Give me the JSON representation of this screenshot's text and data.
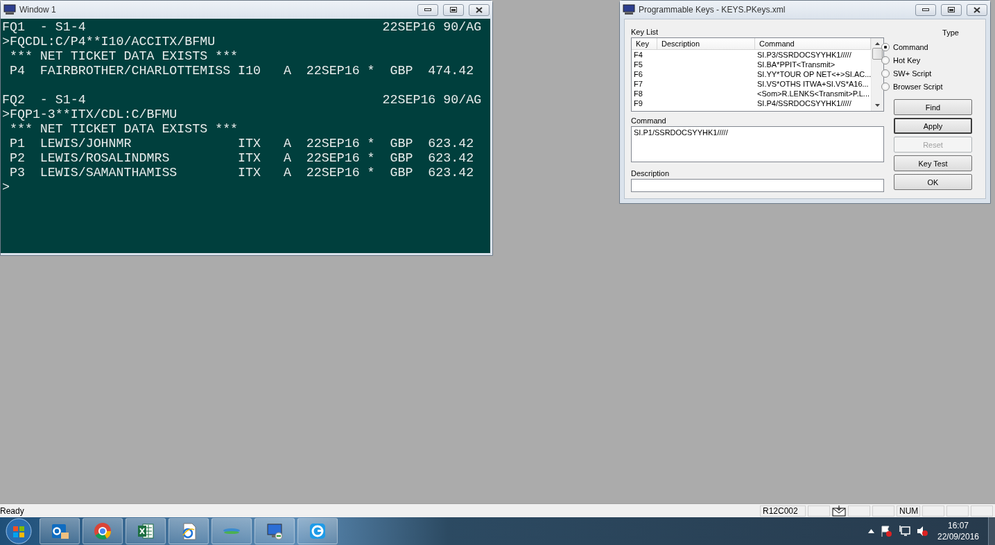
{
  "terminal_window": {
    "title": "Window 1",
    "blocks": [
      {
        "lines": [
          "FQ1  - S1-4                                       22SEP16 90/AG",
          ">FQCDL:C/P4**I10/ACCITX/BFMU",
          " *** NET TICKET DATA EXISTS ***",
          " P4  FAIRBROTHER/CHARLOTTEMISS I10   A  22SEP16 *  GBP  474.42"
        ]
      },
      {
        "lines": [
          "FQ2  - S1-4                                       22SEP16 90/AG",
          ">FQP1-3**ITX/CDL:C/BFMU",
          " *** NET TICKET DATA EXISTS ***",
          " P1  LEWIS/JOHNMR              ITX   A  22SEP16 *  GBP  623.42",
          " P2  LEWIS/ROSALINDMRS         ITX   A  22SEP16 *  GBP  623.42",
          " P3  LEWIS/SAMANTHAMISS        ITX   A  22SEP16 *  GBP  623.42",
          ">"
        ]
      }
    ]
  },
  "keys_window": {
    "title": "Programmable Keys - KEYS.PKeys.xml",
    "key_list": {
      "label": "Key List",
      "columns": [
        "Key",
        "Description",
        "Command"
      ],
      "rows": [
        {
          "key": "F4",
          "command": "SI.P3/SSRDOCSYYHK1/////"
        },
        {
          "key": "F5",
          "command": "SI.BA*PPIT<Transmit>"
        },
        {
          "key": "F6",
          "command": "SI.YY*TOUR OP NET<+>SI.AC..."
        },
        {
          "key": "F7",
          "command": "SI.VS*OTHS ITWA+SI.VS*A16..."
        },
        {
          "key": "F8",
          "command": "<Som>R.LENKS<Transmit>P.L..."
        },
        {
          "key": "F9",
          "command": "SI.P4/SSRDOCSYYHK1/////"
        }
      ]
    },
    "command": {
      "label": "Command",
      "value": "SI.P1/SSRDOCSYYHK1/////"
    },
    "description": {
      "label": "Description"
    },
    "type": {
      "label": "Type",
      "options": [
        {
          "label": "Command",
          "selected": true
        },
        {
          "label": "Hot Key",
          "selected": false
        },
        {
          "label": "SW+ Script",
          "selected": false
        },
        {
          "label": "Browser Script",
          "selected": false
        }
      ]
    },
    "buttons": [
      {
        "label": "Find",
        "disabled": false,
        "default": false
      },
      {
        "label": "Apply",
        "disabled": false,
        "default": true
      },
      {
        "label": "Reset",
        "disabled": true,
        "default": false
      },
      {
        "label": "Key Test",
        "disabled": false,
        "default": false
      },
      {
        "label": "OK",
        "disabled": false,
        "default": false
      }
    ]
  },
  "status_bar": {
    "text": "Ready",
    "panes": [
      {
        "kind": "text",
        "text": "R12C002"
      },
      {
        "kind": "empty"
      },
      {
        "kind": "mail"
      },
      {
        "kind": "empty"
      },
      {
        "kind": "empty"
      },
      {
        "kind": "text",
        "text": "NUM"
      },
      {
        "kind": "empty"
      },
      {
        "kind": "empty"
      },
      {
        "kind": "empty"
      }
    ]
  },
  "taskbar": {
    "clock": {
      "time": "16:07",
      "date": "22/09/2016"
    }
  }
}
